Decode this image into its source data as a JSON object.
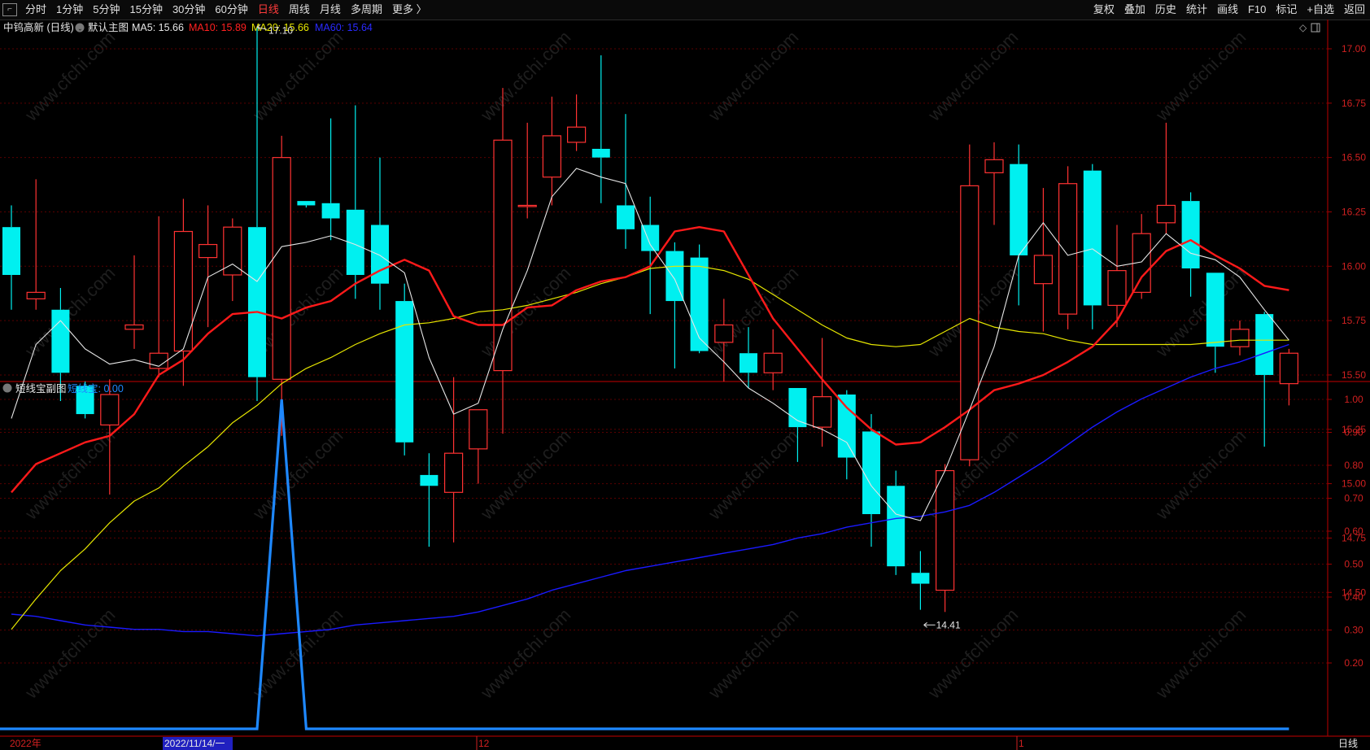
{
  "toolbar": {
    "back_glyph": "⌐",
    "periods": [
      "分时",
      "1分钟",
      "5分钟",
      "15分钟",
      "30分钟",
      "60分钟",
      "日线",
      "周线",
      "月线",
      "多周期",
      "更多 〉"
    ],
    "active_period": "日线",
    "right": [
      "复权",
      "叠加",
      "历史",
      "统计",
      "画线",
      "F10",
      "标记",
      "+自选",
      "返回"
    ]
  },
  "main_panel": {
    "stock_name": "中钨高新 (日线)",
    "template_label": "默认主图",
    "ma_labels": [
      "MA5: 15.66",
      "MA10: 15.89",
      "MA20: 15.66",
      "MA60: 15.64"
    ],
    "high_label": "17.10",
    "low_label": "14.41"
  },
  "sub_panel": {
    "title": "短线宝副图",
    "indicator_label": "短线宝: 0.00"
  },
  "bottom_axis": {
    "labels": [
      "2022年",
      "2022/11/14/一",
      "12",
      "1"
    ],
    "period_box": "日线"
  },
  "watermark": "www.cfchi.com",
  "colors": {
    "up": "#ff3232",
    "down": "#00f0f0",
    "ma5": "#e6e6e6",
    "ma10": "#ff1a1a",
    "ma20": "#e6e600",
    "ma60": "#1a1aff",
    "indicator": "#1e88ff",
    "grid": "#5a0000"
  },
  "chart_data": {
    "type": "candlestick",
    "price_axis": {
      "ticks": [
        17.0,
        16.75,
        16.5,
        16.25,
        16.0,
        15.75,
        15.5,
        15.25,
        15.0,
        14.75,
        14.5
      ]
    },
    "candles": [
      {
        "o": 16.18,
        "h": 16.28,
        "l": 15.8,
        "c": 15.96
      },
      {
        "o": 15.85,
        "h": 16.4,
        "l": 15.8,
        "c": 15.88
      },
      {
        "o": 15.8,
        "h": 15.9,
        "l": 15.38,
        "c": 15.51
      },
      {
        "o": 15.45,
        "h": 15.47,
        "l": 15.3,
        "c": 15.32
      },
      {
        "o": 15.27,
        "h": 15.48,
        "l": 14.95,
        "c": 15.41
      },
      {
        "o": 15.71,
        "h": 16.05,
        "l": 15.62,
        "c": 15.73
      },
      {
        "o": 15.53,
        "h": 16.23,
        "l": 15.49,
        "c": 15.6
      },
      {
        "o": 15.61,
        "h": 16.31,
        "l": 15.45,
        "c": 16.16
      },
      {
        "o": 16.04,
        "h": 16.28,
        "l": 15.72,
        "c": 16.1
      },
      {
        "o": 15.96,
        "h": 16.22,
        "l": 15.84,
        "c": 16.18
      },
      {
        "o": 16.18,
        "h": 17.1,
        "l": 15.38,
        "c": 15.49
      },
      {
        "o": 15.48,
        "h": 16.6,
        "l": 15.22,
        "c": 16.5
      },
      {
        "o": 16.3,
        "h": 16.3,
        "l": 16.27,
        "c": 16.28
      },
      {
        "o": 16.29,
        "h": 16.68,
        "l": 16.12,
        "c": 16.22
      },
      {
        "o": 16.26,
        "h": 16.74,
        "l": 15.85,
        "c": 15.96
      },
      {
        "o": 16.19,
        "h": 16.5,
        "l": 15.8,
        "c": 15.92
      },
      {
        "o": 15.84,
        "h": 15.92,
        "l": 15.13,
        "c": 15.19
      },
      {
        "o": 15.04,
        "h": 15.14,
        "l": 14.71,
        "c": 14.99
      },
      {
        "o": 14.96,
        "h": 15.49,
        "l": 14.73,
        "c": 15.14
      },
      {
        "o": 15.16,
        "h": 15.34,
        "l": 15.0,
        "c": 15.34
      },
      {
        "o": 15.52,
        "h": 16.82,
        "l": 15.23,
        "c": 16.58
      },
      {
        "o": 16.28,
        "h": 16.66,
        "l": 16.22,
        "c": 16.28
      },
      {
        "o": 16.41,
        "h": 16.78,
        "l": 16.28,
        "c": 16.6
      },
      {
        "o": 16.57,
        "h": 16.79,
        "l": 16.53,
        "c": 16.64
      },
      {
        "o": 16.54,
        "h": 16.97,
        "l": 16.29,
        "c": 16.5
      },
      {
        "o": 16.28,
        "h": 16.7,
        "l": 16.08,
        "c": 16.17
      },
      {
        "o": 16.19,
        "h": 16.32,
        "l": 15.78,
        "c": 16.07
      },
      {
        "o": 16.07,
        "h": 16.11,
        "l": 15.53,
        "c": 15.84
      },
      {
        "o": 16.04,
        "h": 16.1,
        "l": 15.6,
        "c": 15.61
      },
      {
        "o": 15.65,
        "h": 15.85,
        "l": 15.47,
        "c": 15.73
      },
      {
        "o": 15.6,
        "h": 15.72,
        "l": 15.44,
        "c": 15.51
      },
      {
        "o": 15.51,
        "h": 15.71,
        "l": 15.43,
        "c": 15.6
      },
      {
        "o": 15.44,
        "h": 15.44,
        "l": 15.1,
        "c": 15.26
      },
      {
        "o": 15.26,
        "h": 15.67,
        "l": 15.17,
        "c": 15.4
      },
      {
        "o": 15.41,
        "h": 15.43,
        "l": 15.02,
        "c": 15.12
      },
      {
        "o": 15.24,
        "h": 15.32,
        "l": 14.71,
        "c": 14.86
      },
      {
        "o": 14.99,
        "h": 15.06,
        "l": 14.58,
        "c": 14.62
      },
      {
        "o": 14.59,
        "h": 14.69,
        "l": 14.42,
        "c": 14.54
      },
      {
        "o": 14.51,
        "h": 15.09,
        "l": 14.41,
        "c": 15.06
      },
      {
        "o": 15.11,
        "h": 16.56,
        "l": 15.08,
        "c": 16.37
      },
      {
        "o": 16.43,
        "h": 16.57,
        "l": 16.19,
        "c": 16.49
      },
      {
        "o": 16.47,
        "h": 16.56,
        "l": 15.82,
        "c": 16.05
      },
      {
        "o": 15.92,
        "h": 16.36,
        "l": 15.7,
        "c": 16.05
      },
      {
        "o": 15.78,
        "h": 16.46,
        "l": 15.71,
        "c": 16.38
      },
      {
        "o": 16.44,
        "h": 16.47,
        "l": 15.71,
        "c": 15.82
      },
      {
        "o": 15.82,
        "h": 16.19,
        "l": 15.72,
        "c": 15.98
      },
      {
        "o": 15.88,
        "h": 16.24,
        "l": 15.85,
        "c": 16.15
      },
      {
        "o": 16.2,
        "h": 16.66,
        "l": 16.15,
        "c": 16.28
      },
      {
        "o": 16.3,
        "h": 16.34,
        "l": 15.86,
        "c": 15.99
      },
      {
        "o": 15.97,
        "h": 15.97,
        "l": 15.51,
        "c": 15.63
      },
      {
        "o": 15.63,
        "h": 15.75,
        "l": 15.59,
        "c": 15.71
      },
      {
        "o": 15.78,
        "h": 15.79,
        "l": 15.17,
        "c": 15.5
      },
      {
        "o": 15.46,
        "h": 15.62,
        "l": 15.36,
        "c": 15.6
      }
    ],
    "ma5": [
      15.3,
      15.64,
      15.75,
      15.62,
      15.55,
      15.57,
      15.54,
      15.62,
      15.95,
      16.01,
      15.93,
      16.09,
      16.11,
      16.14,
      16.1,
      16.05,
      15.97,
      15.58,
      15.32,
      15.37,
      15.71,
      15.98,
      16.32,
      16.45,
      16.41,
      16.38,
      16.1,
      15.94,
      15.67,
      15.56,
      15.44,
      15.37,
      15.29,
      15.25,
      15.19,
      14.99,
      14.86,
      14.83,
      15.06,
      15.34,
      15.63,
      16.05,
      16.2,
      16.05,
      16.08,
      16.0,
      16.02,
      16.15,
      16.06,
      16.03,
      15.95,
      15.8,
      15.66
    ],
    "ma10": [
      14.96,
      15.09,
      15.14,
      15.19,
      15.22,
      15.32,
      15.5,
      15.57,
      15.69,
      15.78,
      15.79,
      15.76,
      15.81,
      15.84,
      15.92,
      15.98,
      16.03,
      15.98,
      15.77,
      15.73,
      15.73,
      15.81,
      15.82,
      15.89,
      15.93,
      15.95,
      16.0,
      16.16,
      16.18,
      16.16,
      15.96,
      15.76,
      15.62,
      15.48,
      15.35,
      15.25,
      15.18,
      15.19,
      15.26,
      15.34,
      15.43,
      15.46,
      15.5,
      15.56,
      15.63,
      15.75,
      15.95,
      16.07,
      16.12,
      16.05,
      15.99,
      15.91,
      15.89
    ],
    "ma20": [
      14.33,
      14.47,
      14.6,
      14.7,
      14.82,
      14.92,
      14.98,
      15.08,
      15.17,
      15.28,
      15.36,
      15.46,
      15.53,
      15.58,
      15.64,
      15.69,
      15.73,
      15.74,
      15.76,
      15.79,
      15.8,
      15.82,
      15.85,
      15.88,
      15.92,
      15.95,
      15.99,
      16.0,
      16.0,
      15.98,
      15.94,
      15.87,
      15.8,
      15.73,
      15.67,
      15.64,
      15.63,
      15.64,
      15.7,
      15.76,
      15.72,
      15.7,
      15.69,
      15.66,
      15.64,
      15.64,
      15.64,
      15.64,
      15.64,
      15.65,
      15.66,
      15.66,
      15.66
    ],
    "ma60": [
      14.4,
      14.39,
      14.37,
      14.35,
      14.34,
      14.33,
      14.33,
      14.32,
      14.32,
      14.31,
      14.3,
      14.31,
      14.32,
      14.33,
      14.35,
      14.36,
      14.37,
      14.38,
      14.39,
      14.41,
      14.44,
      14.47,
      14.51,
      14.54,
      14.57,
      14.6,
      14.62,
      14.64,
      14.66,
      14.68,
      14.7,
      14.72,
      14.75,
      14.77,
      14.8,
      14.82,
      14.84,
      14.85,
      14.87,
      14.9,
      14.96,
      15.03,
      15.1,
      15.18,
      15.26,
      15.33,
      15.39,
      15.44,
      15.49,
      15.53,
      15.56,
      15.6,
      15.64
    ],
    "indicator": {
      "name": "短线宝",
      "y_ticks": [
        1.0,
        0.9,
        0.8,
        0.7,
        0.6,
        0.5,
        0.4,
        0.3,
        0.2
      ],
      "values": [
        0,
        0,
        0,
        0,
        0,
        0,
        0,
        0,
        0,
        0,
        0,
        1,
        0,
        0,
        0,
        0,
        0,
        0,
        0,
        0,
        0,
        0,
        0,
        0,
        0,
        0,
        0,
        0,
        0,
        0,
        0,
        0,
        0,
        0,
        0,
        0,
        0,
        0,
        0,
        0,
        0,
        0,
        0,
        0,
        0,
        0,
        0,
        0,
        0,
        0,
        0,
        0,
        0
      ]
    }
  }
}
